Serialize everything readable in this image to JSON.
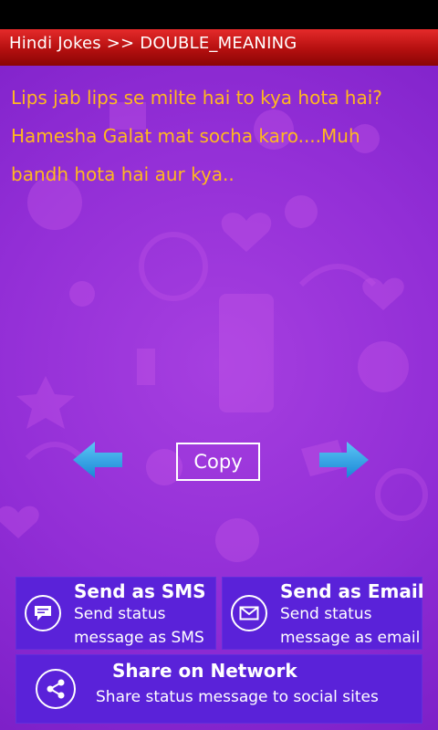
{
  "header": {
    "title": "Hindi Jokes >> DOUBLE_MEANING"
  },
  "joke": {
    "lines": [
      "Lips jab lips se milte hai to kya hota hai?",
      "Hamesha Galat mat socha karo....Muh",
      "bandh hota hai aur kya.."
    ]
  },
  "controls": {
    "copy_label": "Copy",
    "prev_icon": "arrow-left-icon",
    "next_icon": "arrow-right-icon"
  },
  "actions": {
    "sms": {
      "title": "Send as SMS",
      "sub1": "Send status",
      "sub2": "message as SMS",
      "icon": "message-icon"
    },
    "email": {
      "title": "Send as Email",
      "sub1": "Send status",
      "sub2": "message as email",
      "icon": "envelope-icon"
    },
    "share": {
      "title": "Share on Network",
      "sub": "Share status message to social sites",
      "icon": "share-icon"
    }
  },
  "colors": {
    "header": "#c41414",
    "background": "#922ed6",
    "joke_text": "#ffb81f",
    "button": "#5a22d9",
    "arrow": "#2aa7e8"
  }
}
